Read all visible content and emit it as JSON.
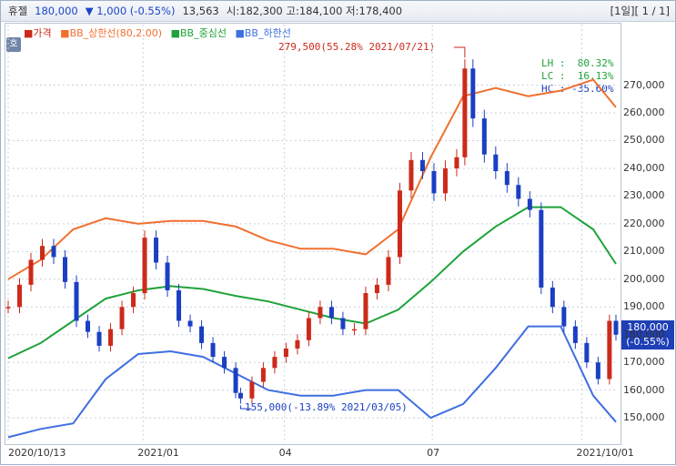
{
  "header": {
    "name": "휴젤",
    "price": "180,000",
    "change": "▼ 1,000 (-0.55%)",
    "volume": "13,563",
    "ohl": "시:182,300 고:184,100 저:178,400",
    "page": "[1일][ 1 / 1]"
  },
  "legend": {
    "price": "가격",
    "upper": "BB_상한선(80,2.00)",
    "middle": "BB_중심선",
    "lower": "BB_하한선"
  },
  "stats": {
    "lh": "LH :  80.32%",
    "lc": "LC :  16.13%",
    "hc": "HC : -35.60%"
  },
  "annotations": {
    "high": "279,500(55.28% 2021/07/21)",
    "low": "155,000(-13.89% 2021/03/05)"
  },
  "last_price": {
    "price": "180,000",
    "change": "(-0.55%)"
  },
  "colors": {
    "price_up": "#cc2a1a",
    "price_down": "#1b3fc2",
    "upper": "#f07030",
    "middle": "#1fa23a",
    "lower": "#3f6fe0",
    "accent": "#1f3fb6"
  },
  "chart_data": {
    "type": "line",
    "ylim": [
      141500,
      282000
    ],
    "y_ticks": [
      150000,
      160000,
      170000,
      180000,
      190000,
      200000,
      210000,
      220000,
      230000,
      240000,
      250000,
      260000,
      270000
    ],
    "y_tick_labels": [
      "150,000",
      "160,000",
      "170,000",
      "180,000",
      "190,000",
      "200,000",
      "210,000",
      "220,000",
      "230,000",
      "240,000",
      "250,000",
      "260,000",
      "270,000"
    ],
    "x_labels": [
      "2020/10/13",
      "2021/01",
      "04",
      "07",
      "2021/10/01"
    ],
    "x_label_dates": [
      "2020-10-13",
      "2021-01-04",
      "2021-04-01",
      "2021-07-01",
      "2021-10-01"
    ],
    "x_range": [
      "2020-10-13",
      "2021-10-22"
    ],
    "series": [
      {
        "name": "가격",
        "x": [
          "2020-10-13",
          "2020-10-20",
          "2020-10-27",
          "2020-11-03",
          "2020-11-10",
          "2020-11-17",
          "2020-11-24",
          "2020-12-01",
          "2020-12-08",
          "2020-12-15",
          "2020-12-22",
          "2020-12-29",
          "2021-01-05",
          "2021-01-12",
          "2021-01-19",
          "2021-01-26",
          "2021-02-02",
          "2021-02-09",
          "2021-02-16",
          "2021-02-23",
          "2021-03-02",
          "2021-03-05",
          "2021-03-12",
          "2021-03-19",
          "2021-03-26",
          "2021-04-02",
          "2021-04-09",
          "2021-04-16",
          "2021-04-23",
          "2021-04-30",
          "2021-05-07",
          "2021-05-14",
          "2021-05-21",
          "2021-05-28",
          "2021-06-04",
          "2021-06-11",
          "2021-06-18",
          "2021-06-25",
          "2021-07-02",
          "2021-07-09",
          "2021-07-16",
          "2021-07-21",
          "2021-07-26",
          "2021-08-02",
          "2021-08-09",
          "2021-08-16",
          "2021-08-23",
          "2021-08-30",
          "2021-09-06",
          "2021-09-13",
          "2021-09-20",
          "2021-09-27",
          "2021-10-04",
          "2021-10-11",
          "2021-10-18",
          "2021-10-22"
        ],
        "values": [
          190000,
          198000,
          207000,
          212000,
          208000,
          199000,
          185000,
          181000,
          176000,
          182000,
          190000,
          195000,
          215000,
          206000,
          196000,
          185000,
          183000,
          177000,
          172000,
          168000,
          159000,
          157000,
          163000,
          168000,
          172000,
          175000,
          178000,
          186000,
          190000,
          186000,
          182000,
          182000,
          195000,
          198000,
          208000,
          232000,
          243000,
          239000,
          231000,
          240000,
          244000,
          276000,
          258000,
          245000,
          239000,
          234000,
          229000,
          225000,
          197000,
          190000,
          183000,
          177000,
          170000,
          164000,
          185000,
          180000
        ]
      },
      {
        "name": "BB_상한선(80,2.00)",
        "x": [
          "2020-10-13",
          "2020-11-02",
          "2020-11-22",
          "2020-12-12",
          "2021-01-01",
          "2021-01-21",
          "2021-02-10",
          "2021-03-02",
          "2021-03-22",
          "2021-04-11",
          "2021-05-01",
          "2021-05-21",
          "2021-06-10",
          "2021-06-30",
          "2021-07-20",
          "2021-08-09",
          "2021-08-29",
          "2021-09-18",
          "2021-10-08",
          "2021-10-22"
        ],
        "values": [
          200000,
          207000,
          218000,
          222000,
          220000,
          221000,
          221000,
          219000,
          214000,
          211000,
          211000,
          209000,
          218000,
          244000,
          266000,
          269000,
          266000,
          268000,
          272000,
          262000
        ]
      },
      {
        "name": "BB_중심선",
        "x": [
          "2020-10-13",
          "2020-11-02",
          "2020-11-22",
          "2020-12-12",
          "2021-01-01",
          "2021-01-21",
          "2021-02-10",
          "2021-03-02",
          "2021-03-22",
          "2021-04-11",
          "2021-05-01",
          "2021-05-21",
          "2021-06-10",
          "2021-06-30",
          "2021-07-20",
          "2021-08-09",
          "2021-08-29",
          "2021-09-18",
          "2021-10-08",
          "2021-10-22"
        ],
        "values": [
          171500,
          177000,
          185000,
          193000,
          196000,
          197500,
          196500,
          194000,
          192000,
          189000,
          186000,
          184000,
          189000,
          199000,
          210000,
          219000,
          226000,
          226000,
          218000,
          205500
        ]
      },
      {
        "name": "BB_하한선",
        "x": [
          "2020-10-13",
          "2020-11-02",
          "2020-11-22",
          "2020-12-12",
          "2021-01-01",
          "2021-01-21",
          "2021-02-10",
          "2021-03-02",
          "2021-03-22",
          "2021-04-11",
          "2021-05-01",
          "2021-05-21",
          "2021-06-10",
          "2021-06-30",
          "2021-07-20",
          "2021-08-09",
          "2021-08-29",
          "2021-09-18",
          "2021-10-08",
          "2021-10-22"
        ],
        "values": [
          143000,
          146000,
          148000,
          164000,
          173000,
          174000,
          172000,
          166000,
          160000,
          158000,
          158000,
          160000,
          160000,
          150000,
          155000,
          168000,
          183000,
          183000,
          158000,
          148500
        ]
      }
    ]
  }
}
